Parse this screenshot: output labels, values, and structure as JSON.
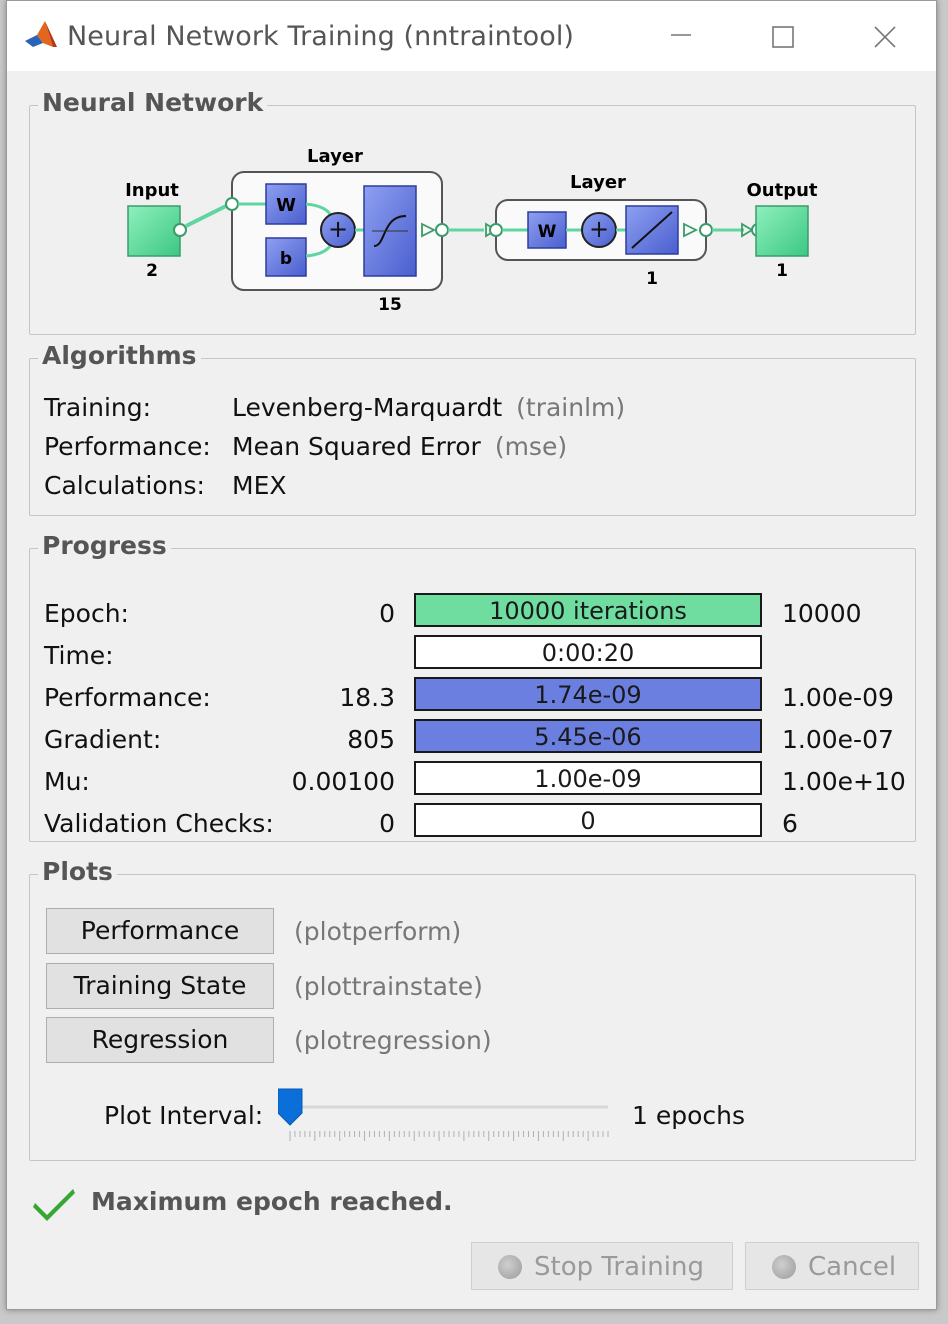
{
  "window": {
    "title": "Neural Network Training (nntraintool)"
  },
  "neural_network": {
    "group_title": "Neural Network",
    "input_label": "Input",
    "input_size": "2",
    "hidden_layer_label": "Layer",
    "hidden_weight": "W",
    "hidden_bias": "b",
    "hidden_size": "15",
    "output_layer_label": "Layer",
    "output_weight": "W",
    "output_layer_size": "1",
    "output_label": "Output",
    "output_size": "1",
    "colors": {
      "input_output": "#6fdda0",
      "layer_block": "#6b7fe0"
    }
  },
  "algorithms": {
    "group_title": "Algorithms",
    "rows": [
      {
        "label": "Training:",
        "value": "Levenberg-Marquardt",
        "func": "(trainlm)"
      },
      {
        "label": "Performance:",
        "value": "Mean Squared Error",
        "func": "(mse)"
      },
      {
        "label": "Calculations:",
        "value": "MEX",
        "func": ""
      }
    ]
  },
  "progress": {
    "group_title": "Progress",
    "rows": [
      {
        "label": "Epoch:",
        "start": "0",
        "current": "10000 iterations",
        "end": "10000",
        "fill": 1.0,
        "fill_color": "#6fdda0"
      },
      {
        "label": "Time:",
        "start": "",
        "current": "0:00:20",
        "end": "",
        "fill": 0,
        "fill_color": "#ffffff"
      },
      {
        "label": "Performance:",
        "start": "18.3",
        "current": "1.74e-09",
        "end": "1.00e-09",
        "fill": 1.0,
        "fill_color": "#6b7fe0"
      },
      {
        "label": "Gradient:",
        "start": "805",
        "current": "5.45e-06",
        "end": "1.00e-07",
        "fill": 1.0,
        "fill_color": "#6b7fe0"
      },
      {
        "label": "Mu:",
        "start": "0.00100",
        "current": "1.00e-09",
        "end": "1.00e+10",
        "fill": 0,
        "fill_color": "#ffffff"
      },
      {
        "label": "Validation Checks:",
        "start": "0",
        "current": "0",
        "end": "6",
        "fill": 0,
        "fill_color": "#ffffff"
      }
    ]
  },
  "plots": {
    "group_title": "Plots",
    "buttons": [
      {
        "label": "Performance",
        "func": "(plotperform)"
      },
      {
        "label": "Training State",
        "func": "(plottrainstate)"
      },
      {
        "label": "Regression",
        "func": "(plotregression)"
      }
    ],
    "interval_label": "Plot Interval:",
    "interval_value": "1 epochs",
    "interval_slider_fraction": 0.0
  },
  "status": {
    "message": "Maximum epoch reached."
  },
  "footer": {
    "stop_label": "Stop Training",
    "cancel_label": "Cancel"
  }
}
